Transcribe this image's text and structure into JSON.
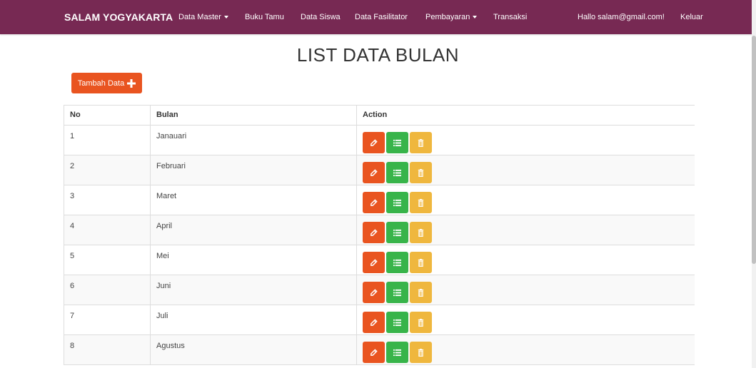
{
  "navbar": {
    "brand": "SALAM YOGYAKARTA",
    "items": [
      {
        "label": "Data Master",
        "dropdown": true
      },
      {
        "label": "Buku Tamu",
        "dropdown": false
      },
      {
        "label": "Data Siswa",
        "dropdown": false
      },
      {
        "label": "Data Fasilitator",
        "dropdown": false
      },
      {
        "label": "Pembayaran",
        "dropdown": true
      },
      {
        "label": "Transaksi",
        "dropdown": false
      }
    ],
    "greeting": "Hallo salam@gmail.com!",
    "logout": "Keluar"
  },
  "page": {
    "title": "LIST DATA BULAN",
    "add_button": "Tambah Data"
  },
  "table": {
    "headers": [
      "No",
      "Bulan",
      "Action"
    ],
    "rows": [
      {
        "no": "1",
        "bulan": "Janauari"
      },
      {
        "no": "2",
        "bulan": "Februari"
      },
      {
        "no": "3",
        "bulan": "Maret"
      },
      {
        "no": "4",
        "bulan": "April"
      },
      {
        "no": "5",
        "bulan": "Mei"
      },
      {
        "no": "6",
        "bulan": "Juni"
      },
      {
        "no": "7",
        "bulan": "Juli"
      },
      {
        "no": "8",
        "bulan": "Agustus"
      }
    ],
    "action_icons": [
      "edit-icon",
      "list-icon",
      "trash-icon"
    ]
  },
  "colors": {
    "navbar": "#772953",
    "primary": "#e95420",
    "success": "#38b44a",
    "warning": "#efb73e"
  }
}
